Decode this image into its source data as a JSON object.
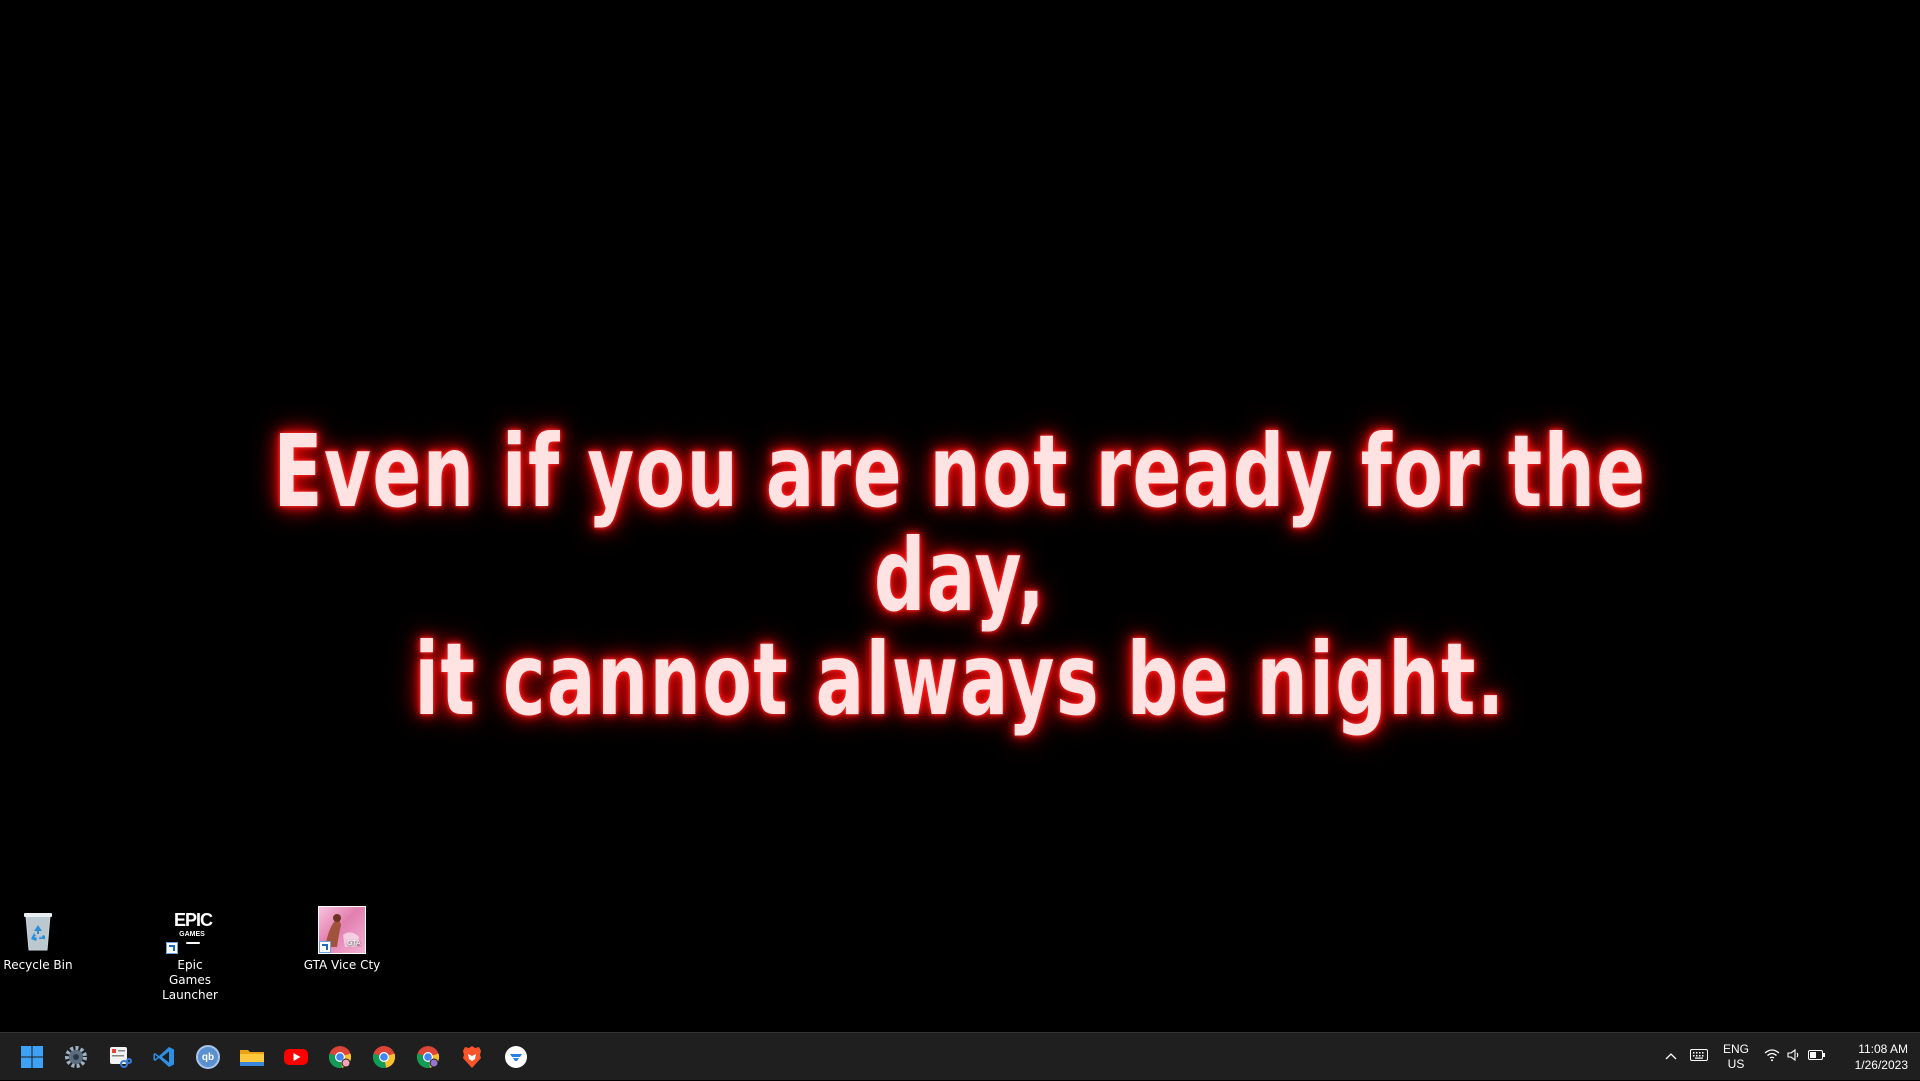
{
  "wallpaper": {
    "quote_line1": "Even if you are not ready for the day,",
    "quote_line2": "it cannot always be night.",
    "glow_color": "#ff1a1a",
    "text_color": "#ffe3e3"
  },
  "desktop_icons": [
    {
      "label": "Recycle Bin",
      "icon": "recycle-bin-icon"
    },
    {
      "label": "Epic Games Launcher",
      "icon": "epic-games-icon",
      "logo_text": "EPIC",
      "logo_sub": "GAMES"
    },
    {
      "label": "GTA Vice Cty",
      "icon": "gta-vice-city-icon"
    }
  ],
  "taskbar": {
    "apps": [
      {
        "name": "start",
        "icon": "windows-start-icon"
      },
      {
        "name": "settings",
        "icon": "gear-icon"
      },
      {
        "name": "snipping-tool",
        "icon": "snipping-tool-icon"
      },
      {
        "name": "vscode",
        "icon": "vscode-icon"
      },
      {
        "name": "qbittorrent",
        "icon": "qbittorrent-icon",
        "glyph": "qb"
      },
      {
        "name": "file-explorer",
        "icon": "folder-icon"
      },
      {
        "name": "youtube",
        "icon": "youtube-icon"
      },
      {
        "name": "chrome-1",
        "icon": "chrome-icon"
      },
      {
        "name": "chrome-2",
        "icon": "chrome-icon"
      },
      {
        "name": "chrome-3",
        "icon": "chrome-icon"
      },
      {
        "name": "brave",
        "icon": "brave-icon"
      },
      {
        "name": "app-blue",
        "icon": "circle-app-icon"
      }
    ],
    "tray": {
      "overflow_icon": "chevron-up-icon",
      "keyboard_icon": "keyboard-icon",
      "lang_top": "ENG",
      "lang_bottom": "US",
      "wifi_icon": "wifi-icon",
      "volume_icon": "volume-icon",
      "battery_icon": "battery-icon",
      "time": "11:08 AM",
      "date": "1/26/2023"
    },
    "colors": {
      "background": "#1f1f1f",
      "windows_blue": "#3da2f5",
      "youtube_red": "#ff0000",
      "vscode_blue": "#2f8fe0"
    }
  }
}
